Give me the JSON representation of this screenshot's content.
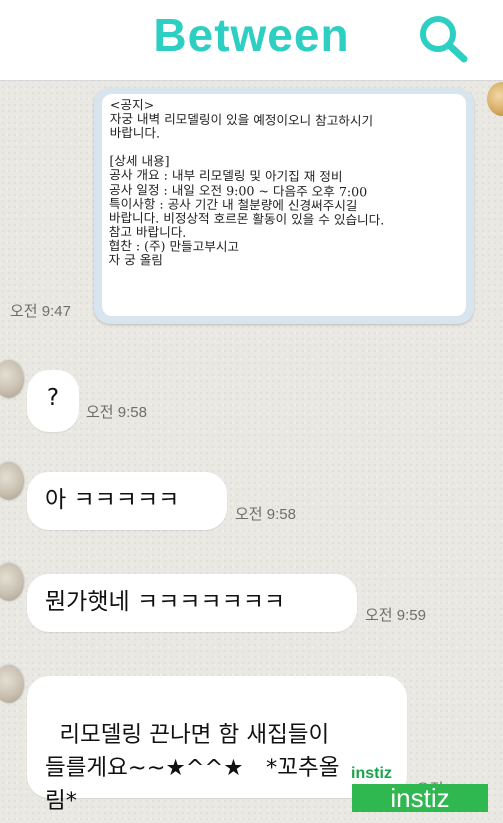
{
  "header": {
    "title": "Between",
    "search_icon": "search-icon",
    "accent_color": "#2ccfc1"
  },
  "notice": {
    "text": "<공지>\n자궁 내벽 리모델링이 있을 예정이오니 참고하시기\n바랍니다.\n\n[상세 내용]\n공사 개요 : 내부 리모델링 및 아기집 재 정비\n공사 일정 : 내일 오전 9:00 ~ 다음주 오후 7:00\n특이사항 : 공사 기간 내 철분량에 신경써주시길\n바랍니다. 비정상적 호르몬 활동이 있을 수 있습니다.\n참고 바랍니다.\n협찬 : (주) 만들고부시고\n자 궁 올림",
    "time": "오전 9:47"
  },
  "messages": [
    {
      "text": "?",
      "time": "오전 9:58"
    },
    {
      "text": "아 ㅋㅋㅋㅋㅋ",
      "time": "오전 9:58"
    },
    {
      "text": "뭔가햇네 ㅋㅋㅋㅋㅋㅋㅋ",
      "time": "오전 9:59"
    },
    {
      "text": "리모델링 끈나면 함 새집들이\n들를게요~~★^^★　*꼬추올\n림*",
      "time": "오전 10:00"
    }
  ],
  "watermark": {
    "small": "instiz",
    "box": "instiz",
    "color": "#2eb84f"
  }
}
